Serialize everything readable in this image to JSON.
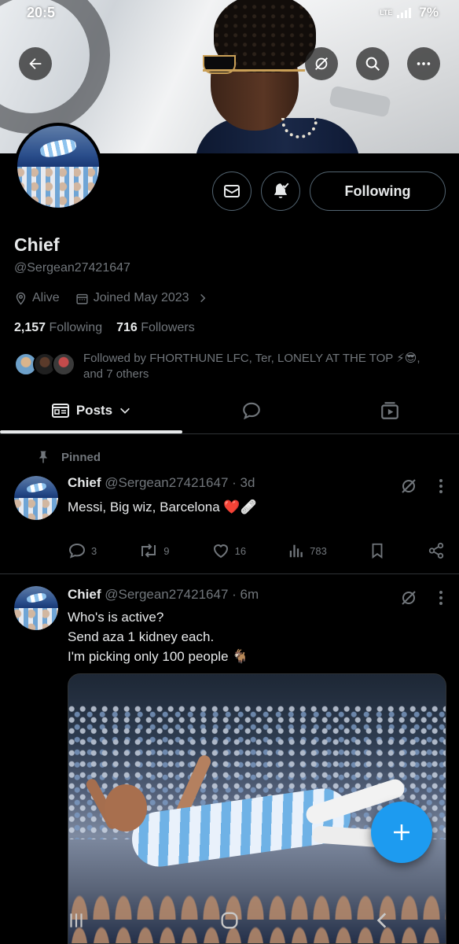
{
  "status_bar": {
    "time": "20:5",
    "network": "LTE",
    "battery": "7%"
  },
  "profile": {
    "display_name": "Chief",
    "handle": "@Sergean27421647",
    "location": "Alive",
    "joined": "Joined May 2023",
    "following_count": "2,157",
    "following_label": "Following",
    "followers_count": "716",
    "followers_label": "Followers",
    "followed_by": "Followed by FHORTHUNE LFC, Ter, LONELY AT THE TOP ⚡😎, and 7 others",
    "follow_button_label": "Following"
  },
  "tabs": {
    "posts_label": "Posts"
  },
  "pinned_label": "Pinned",
  "posts": [
    {
      "name": "Chief",
      "handle": "@Sergean27421647",
      "time": "· 3d",
      "text_lines": [
        "Messi, Big wiz, Barcelona ❤️🩹"
      ],
      "replies": "3",
      "reposts": "9",
      "likes": "16",
      "views": "783"
    },
    {
      "name": "Chief",
      "handle": "@Sergean27421647",
      "time": "· 6m",
      "text_lines": [
        "Who's is active?",
        "Send aza 1 kidney each.",
        "I'm picking only 100 people 🐐"
      ]
    }
  ],
  "colors": {
    "accent": "#1d9bf0",
    "background": "#000000",
    "text_primary": "#e7e9ea",
    "text_secondary": "#71767b",
    "border": "#2f3336"
  }
}
